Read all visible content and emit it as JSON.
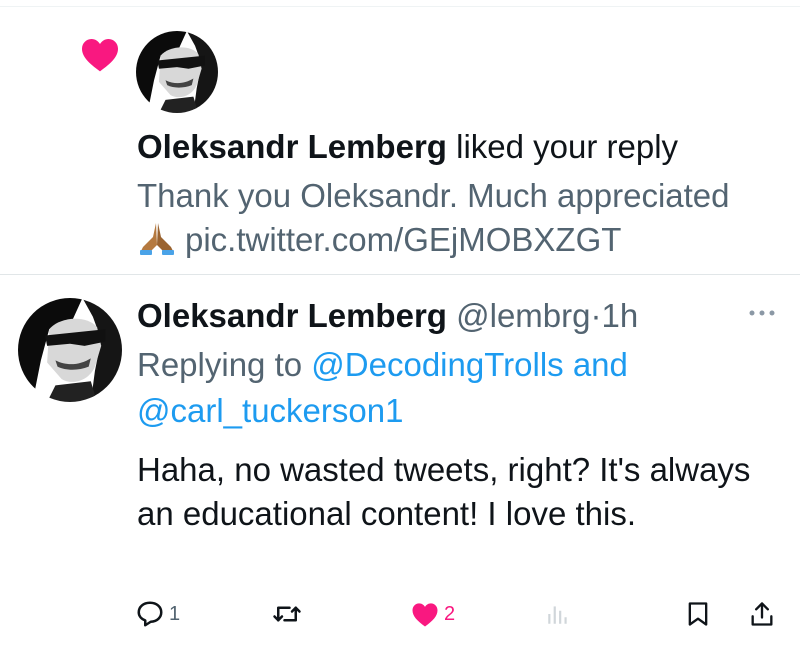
{
  "notification": {
    "user_name": "Oleksandr Lemberg",
    "action_text": "liked your reply",
    "quoted_text": "Thank you Oleksandr. Much appreciated",
    "quoted_link": "pic.twitter.com/GEjMOBXZGT",
    "heart_color": "#f91880"
  },
  "tweet": {
    "user_name": "Oleksandr Lemberg",
    "handle": "@lembrg",
    "separator": "·",
    "time": "1h",
    "replying_prefix": "Replying to",
    "reply_to_1": "@DecodingTrolls",
    "reply_joiner": "and",
    "reply_to_2": "@carl_tuckerson1",
    "text": "Haha, no wasted tweets, right?  It's always an educational content! I love this.",
    "actions": {
      "reply_count": "1",
      "retweet_count": "",
      "like_count": "2",
      "views_count": ""
    }
  },
  "colors": {
    "link": "#1d9bf0",
    "secondary_text": "#536471",
    "like": "#f91880"
  },
  "icons": [
    "heart-icon",
    "praying-hands-emoji",
    "more-icon",
    "reply-icon",
    "retweet-icon",
    "like-icon",
    "views-icon",
    "bookmark-icon",
    "share-icon"
  ]
}
